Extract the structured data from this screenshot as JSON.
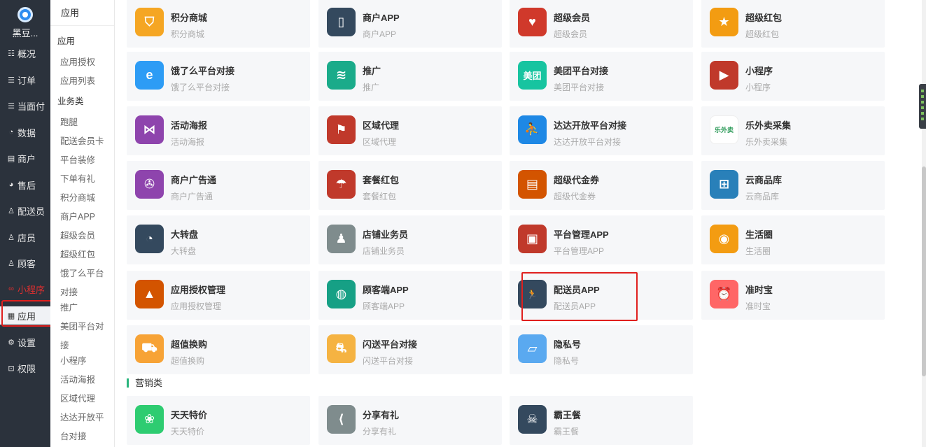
{
  "nav": {
    "brand": "黑豆...",
    "items": [
      {
        "label": "概况",
        "icon": "overview-icon",
        "glyph": "☷"
      },
      {
        "label": "订单",
        "icon": "order-icon",
        "glyph": "☰"
      },
      {
        "label": "当面付",
        "icon": "pay-icon",
        "glyph": "☰"
      },
      {
        "label": "数据",
        "icon": "data-icon",
        "glyph": "◔"
      },
      {
        "label": "商户",
        "icon": "merchant-icon",
        "glyph": "▤"
      },
      {
        "label": "售后",
        "icon": "after-sale-icon",
        "glyph": "◕"
      },
      {
        "label": "配送员",
        "icon": "courier-icon",
        "glyph": "♙"
      },
      {
        "label": "店员",
        "icon": "clerk-icon",
        "glyph": "♙"
      },
      {
        "label": "顾客",
        "icon": "customer-icon",
        "glyph": "♙"
      },
      {
        "label": "小程序",
        "icon": "miniprogram-icon",
        "glyph": "∞"
      },
      {
        "label": "应用",
        "icon": "apps-icon",
        "glyph": "▦"
      },
      {
        "label": "设置",
        "icon": "settings-icon",
        "glyph": "⚙"
      },
      {
        "label": "权限",
        "icon": "lock-icon",
        "glyph": "⊡"
      }
    ]
  },
  "subnav": {
    "title": "应用",
    "items": [
      {
        "label": "应用",
        "type": "group"
      },
      {
        "label": "应用授权",
        "type": "leaf"
      },
      {
        "label": "应用列表",
        "type": "leaf"
      },
      {
        "label": "业务类",
        "type": "group"
      },
      {
        "label": "跑腿",
        "type": "leaf"
      },
      {
        "label": "配送会员卡",
        "type": "leaf"
      },
      {
        "label": "平台装修",
        "type": "leaf"
      },
      {
        "label": "下单有礼",
        "type": "leaf"
      },
      {
        "label": "积分商城",
        "type": "leaf"
      },
      {
        "label": "商户APP",
        "type": "leaf"
      },
      {
        "label": "超级会员",
        "type": "leaf"
      },
      {
        "label": "超级红包",
        "type": "leaf"
      },
      {
        "label": "饿了么平台",
        "type": "leaf"
      },
      {
        "label": "对接",
        "type": "leaf"
      },
      {
        "label": "推广",
        "type": "leaf"
      },
      {
        "label": "美团平台对",
        "type": "leaf"
      },
      {
        "label": "接",
        "type": "leaf"
      },
      {
        "label": "小程序",
        "type": "leaf"
      },
      {
        "label": "活动海报",
        "type": "leaf"
      },
      {
        "label": "区域代理",
        "type": "leaf"
      },
      {
        "label": "达达开放平",
        "type": "leaf"
      },
      {
        "label": "台对接",
        "type": "leaf"
      }
    ]
  },
  "apps": [
    {
      "title": "积分商城",
      "desc": "积分商城",
      "color": "#f5a623",
      "icon": "shield-icon",
      "glyph": "⛉"
    },
    {
      "title": "商户APP",
      "desc": "商户APP",
      "color": "#34495e",
      "icon": "phone-icon",
      "glyph": "▯"
    },
    {
      "title": "超级会员",
      "desc": "超级会员",
      "color": "#d0392b",
      "icon": "heart-icon",
      "glyph": "♥"
    },
    {
      "title": "超级红包",
      "desc": "超级红包",
      "color": "#f39c12",
      "icon": "star-icon",
      "glyph": "★"
    },
    {
      "title": "饿了么平台对接",
      "desc": "饿了么平台对接",
      "color": "#2d9cf5",
      "icon": "eleme-icon",
      "glyph": "e"
    },
    {
      "title": "推广",
      "desc": "推广",
      "color": "#1aab8a",
      "icon": "wifi-icon",
      "glyph": "≋"
    },
    {
      "title": "美团平台对接",
      "desc": "美团平台对接",
      "color": "#17c4a0",
      "icon": "meituan-icon",
      "glyph": "美团"
    },
    {
      "title": "小程序",
      "desc": "小程序",
      "color": "#c0392b",
      "icon": "youtube-icon",
      "glyph": "▶"
    },
    {
      "title": "活动海报",
      "desc": "活动海报",
      "color": "#8e44ad",
      "icon": "vs-icon",
      "glyph": "⋈"
    },
    {
      "title": "区域代理",
      "desc": "区域代理",
      "color": "#c0392b",
      "icon": "flag-icon",
      "glyph": "⚑"
    },
    {
      "title": "达达开放平台对接",
      "desc": "达达开放平台对接",
      "color": "#1e88e5",
      "icon": "dada-icon",
      "glyph": "⛹"
    },
    {
      "title": "乐外卖采集",
      "desc": "乐外卖采集",
      "color": "#ffffff",
      "icon": "lewaimai-icon",
      "glyph": "乐外卖"
    },
    {
      "title": "商户广告通",
      "desc": "商户广告通",
      "color": "#8e44ad",
      "icon": "film-icon",
      "glyph": "✇"
    },
    {
      "title": "套餐红包",
      "desc": "套餐红包",
      "color": "#c0392b",
      "icon": "umbrella-icon",
      "glyph": "☂"
    },
    {
      "title": "超级代金券",
      "desc": "超级代金券",
      "color": "#d35400",
      "icon": "printer-icon",
      "glyph": "▤"
    },
    {
      "title": "云商品库",
      "desc": "云商品库",
      "color": "#2980b9",
      "icon": "windows-icon",
      "glyph": "⊞"
    },
    {
      "title": "大转盘",
      "desc": "大转盘",
      "color": "#34495e",
      "icon": "gauge-icon",
      "glyph": "◔"
    },
    {
      "title": "店铺业务员",
      "desc": "店铺业务员",
      "color": "#7f8c8d",
      "icon": "user-icon",
      "glyph": "♟"
    },
    {
      "title": "平台管理APP",
      "desc": "平台管理APP",
      "color": "#c0392b",
      "icon": "mobile-icon",
      "glyph": "▣"
    },
    {
      "title": "生活圈",
      "desc": "生活圈",
      "color": "#f39c12",
      "icon": "rss-icon",
      "glyph": "◉"
    },
    {
      "title": "应用授权管理",
      "desc": "应用授权管理",
      "color": "#d35400",
      "icon": "cone-icon",
      "glyph": "▲"
    },
    {
      "title": "顾客端APP",
      "desc": "顾客端APP",
      "color": "#16a085",
      "icon": "globe-icon",
      "glyph": "◍"
    },
    {
      "title": "配送员APP",
      "desc": "配送员APP",
      "color": "#34495e",
      "icon": "runner-icon",
      "glyph": "🏃"
    },
    {
      "title": "准时宝",
      "desc": "准时宝",
      "color": "#f66",
      "icon": "alarm-icon",
      "glyph": "⏰"
    },
    {
      "title": "超值换购",
      "desc": "超值换购",
      "color": "#f7a336",
      "icon": "truck-icon",
      "glyph": "⛟"
    },
    {
      "title": "闪送平台对接",
      "desc": "闪送平台对接",
      "color": "#f5b342",
      "icon": "courier-scooter-icon",
      "glyph": "⛐"
    },
    {
      "title": "隐私号",
      "desc": "隐私号",
      "color": "#5aa9f0",
      "icon": "privacy-phone-icon",
      "glyph": "▱"
    }
  ],
  "marketing": {
    "title": "营销类",
    "apps": [
      {
        "title": "天天特价",
        "desc": "天天特价",
        "color": "#2ecc71",
        "icon": "flower-icon",
        "glyph": "❀"
      },
      {
        "title": "分享有礼",
        "desc": "分享有礼",
        "color": "#7f8c8d",
        "icon": "share-icon",
        "glyph": "⟨"
      },
      {
        "title": "霸王餐",
        "desc": "霸王餐",
        "color": "#34495e",
        "icon": "pirate-icon",
        "glyph": "☠"
      }
    ]
  }
}
